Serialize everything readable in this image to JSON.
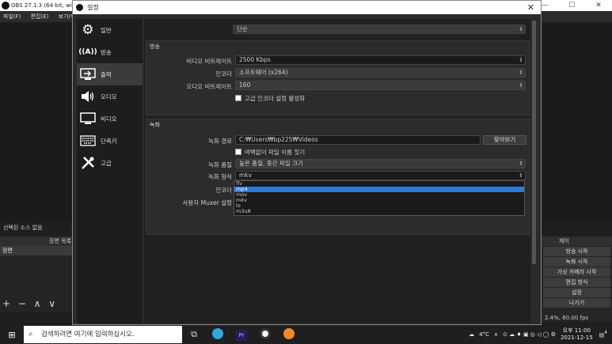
{
  "obs": {
    "title": "OBS 27.1.3 (64-bit, wind",
    "menu": [
      "파일(F)",
      "편집(E)",
      "보기(V"
    ],
    "sources_none": "선택된 소스 없음",
    "scenes_header": "장면 목록",
    "scene_item": "장면",
    "scene_tools": "+ − ∧ ∨",
    "controls_header": "제어",
    "controls": [
      "방송 시작",
      "녹화 시작",
      "가상 카메라 시작",
      "편집 방식",
      "설정",
      "나가기"
    ],
    "status": "2.4%, 60.00 fps"
  },
  "dialog": {
    "title": "설정",
    "close": "✕",
    "sidebar": [
      {
        "label": "일반",
        "icon": "gear-icon",
        "glyph": "⚙"
      },
      {
        "label": "방송",
        "icon": "antenna-icon",
        "glyph": "((A))"
      },
      {
        "label": "출력",
        "icon": "output-icon",
        "glyph": "⇥"
      },
      {
        "label": "오디오",
        "icon": "speaker-icon",
        "glyph": "🔊"
      },
      {
        "label": "비디오",
        "icon": "monitor-icon",
        "glyph": "🖵"
      },
      {
        "label": "단축키",
        "icon": "keyboard-icon",
        "glyph": "⌨"
      },
      {
        "label": "고급",
        "icon": "tools-icon",
        "glyph": "✕"
      }
    ],
    "output_mode_label": "출력 방식",
    "output_mode_value": "단순",
    "stream_group": "방송",
    "video_bitrate_label": "비디오 비트레이트",
    "video_bitrate_value": "2500 Kbps",
    "encoder_label": "인코더",
    "encoder_value": "소프트웨어 (x264)",
    "audio_bitrate_label": "오디오 비트레이트",
    "audio_bitrate_value": "160",
    "advanced_encoder_label": "고급 인코더 설정 활성화",
    "record_group": "녹화",
    "record_path_label": "녹화 경로",
    "record_path_value": "C:₩Users₩bp225₩Videos",
    "browse_label": "찾아보기",
    "no_space_label": "여백없이 파일 이름 짓기",
    "record_quality_label": "녹화 품질",
    "record_quality_value": "높은 품질, 중간 파일 크기",
    "record_format_label": "녹화 형식",
    "record_format_value": "mkv",
    "record_encoder_label": "인코더",
    "muxer_label": "사용자 Muxer 설정",
    "format_options": [
      "flv",
      "mp4",
      "mov",
      "mkv",
      "ts",
      "m3u8"
    ],
    "selected_format_index": 1
  },
  "taskbar": {
    "start": "⊞",
    "search_placeholder": "검색하려면 여기에 입력하십시오.",
    "temp": "4°C",
    "time": "오후 11:00",
    "date": "2021-12-15",
    "notifications": "4"
  }
}
